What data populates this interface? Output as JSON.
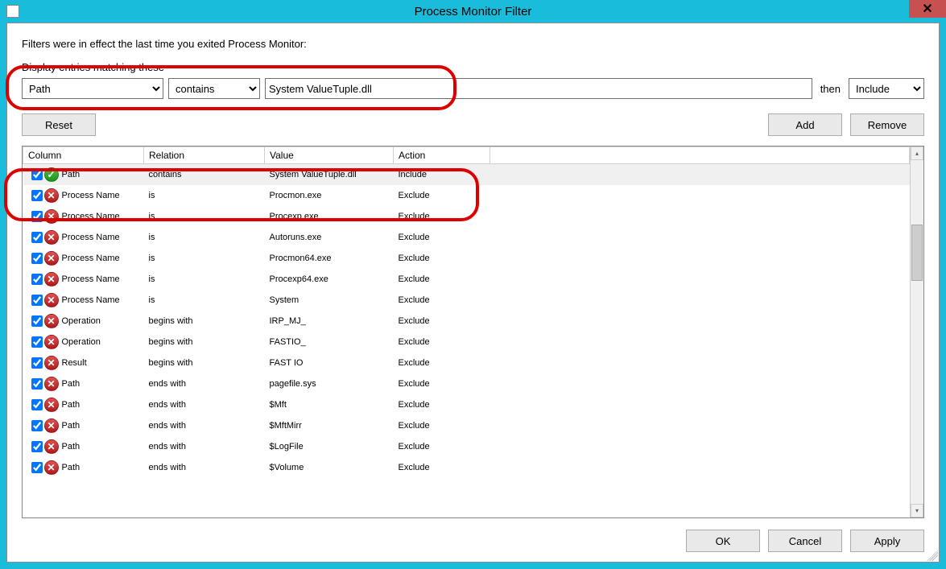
{
  "window": {
    "title": "Process Monitor Filter",
    "close_glyph": "✕"
  },
  "info_text": "Filters were in effect the last time you exited Process Monitor:",
  "sub_header": "Display entries matching these",
  "filter_builder": {
    "column_selected": "Path",
    "relation_selected": "contains",
    "value": "System ValueTuple.dll",
    "then_label": "then",
    "action_selected": "Include"
  },
  "buttons": {
    "reset": "Reset",
    "add": "Add",
    "remove": "Remove",
    "ok": "OK",
    "cancel": "Cancel",
    "apply": "Apply"
  },
  "columns": {
    "c1": "Column",
    "c2": "Relation",
    "c3": "Value",
    "c4": "Action"
  },
  "rows": [
    {
      "checked": true,
      "type": "include",
      "column": "Path",
      "relation": "contains",
      "value": "System ValueTuple.dll",
      "action": "Include",
      "selected": true
    },
    {
      "checked": true,
      "type": "exclude",
      "column": "Process Name",
      "relation": "is",
      "value": "Procmon.exe",
      "action": "Exclude"
    },
    {
      "checked": true,
      "type": "exclude",
      "column": "Process Name",
      "relation": "is",
      "value": "Procexp.exe",
      "action": "Exclude"
    },
    {
      "checked": true,
      "type": "exclude",
      "column": "Process Name",
      "relation": "is",
      "value": "Autoruns.exe",
      "action": "Exclude"
    },
    {
      "checked": true,
      "type": "exclude",
      "column": "Process Name",
      "relation": "is",
      "value": "Procmon64.exe",
      "action": "Exclude"
    },
    {
      "checked": true,
      "type": "exclude",
      "column": "Process Name",
      "relation": "is",
      "value": "Procexp64.exe",
      "action": "Exclude"
    },
    {
      "checked": true,
      "type": "exclude",
      "column": "Process Name",
      "relation": "is",
      "value": "System",
      "action": "Exclude"
    },
    {
      "checked": true,
      "type": "exclude",
      "column": "Operation",
      "relation": "begins with",
      "value": "IRP_MJ_",
      "action": "Exclude"
    },
    {
      "checked": true,
      "type": "exclude",
      "column": "Operation",
      "relation": "begins with",
      "value": "FASTIO_",
      "action": "Exclude"
    },
    {
      "checked": true,
      "type": "exclude",
      "column": "Result",
      "relation": "begins with",
      "value": "FAST IO",
      "action": "Exclude"
    },
    {
      "checked": true,
      "type": "exclude",
      "column": "Path",
      "relation": "ends with",
      "value": "pagefile.sys",
      "action": "Exclude"
    },
    {
      "checked": true,
      "type": "exclude",
      "column": "Path",
      "relation": "ends with",
      "value": "$Mft",
      "action": "Exclude"
    },
    {
      "checked": true,
      "type": "exclude",
      "column": "Path",
      "relation": "ends with",
      "value": "$MftMirr",
      "action": "Exclude"
    },
    {
      "checked": true,
      "type": "exclude",
      "column": "Path",
      "relation": "ends with",
      "value": "$LogFile",
      "action": "Exclude"
    },
    {
      "checked": true,
      "type": "exclude",
      "column": "Path",
      "relation": "ends with",
      "value": "$Volume",
      "action": "Exclude"
    }
  ]
}
